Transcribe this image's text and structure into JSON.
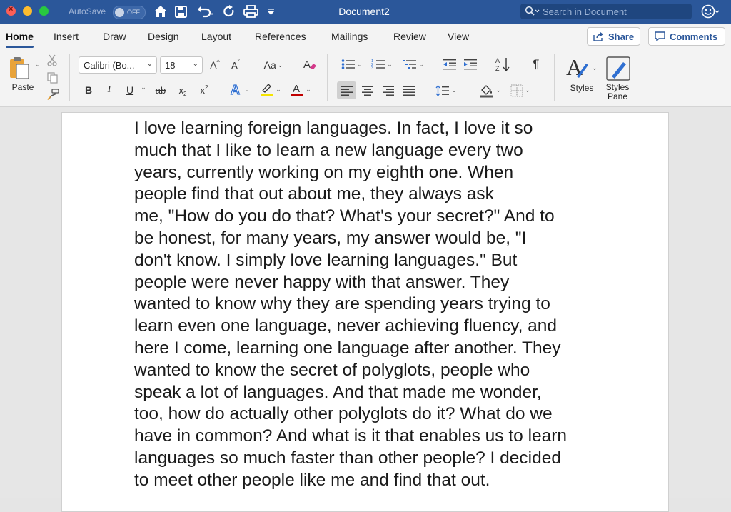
{
  "titlebar": {
    "autosave_label": "AutoSave",
    "autosave_state": "OFF",
    "document_title": "Document2",
    "search_placeholder": "Search in Document"
  },
  "tabs": [
    {
      "label": "Home",
      "active": true
    },
    {
      "label": "Insert"
    },
    {
      "label": "Draw"
    },
    {
      "label": "Design"
    },
    {
      "label": "Layout"
    },
    {
      "label": "References"
    },
    {
      "label": "Mailings"
    },
    {
      "label": "Review"
    },
    {
      "label": "View"
    }
  ],
  "actions": {
    "share_label": "Share",
    "comments_label": "Comments"
  },
  "ribbon": {
    "paste_label": "Paste",
    "font_name": "Calibri (Bo...",
    "font_size": "18",
    "grow_font": "A",
    "shrink_font": "A",
    "change_case": "Aa",
    "bold": "B",
    "italic": "I",
    "underline": "U",
    "strike": "ab",
    "subscript": "x",
    "superscript": "x",
    "styles_label": "Styles",
    "styles_pane_label": "Styles\nPane"
  },
  "colors": {
    "title_bar": "#2b579a",
    "accent": "#2b579a",
    "highlight": "#f5e400",
    "font_color": "#c00000"
  },
  "document": {
    "body": "I love learning foreign languages. In fact, I love it so\nmuch that I like to learn a new language every two\nyears, currently working on my eighth one. When\npeople find that out about me, they always ask\nme, \"How do you do that? What's your secret?\" And to\nbe honest, for many years, my answer would be, \"I\ndon't know. I simply love learning languages.\" But\npeople were never happy with that answer. They\nwanted to know why they are spending years trying to\nlearn even one language, never achieving fluency, and\nhere I come, learning one language after another. They\nwanted to know the secret of polyglots, people who\nspeak a lot of languages. And that made me wonder,\ntoo, how do actually other polyglots do it? What do we\nhave in common? And what is it that enables us to learn\nlanguages so much faster than other people? I decided\nto meet other people like me and find that out."
  }
}
